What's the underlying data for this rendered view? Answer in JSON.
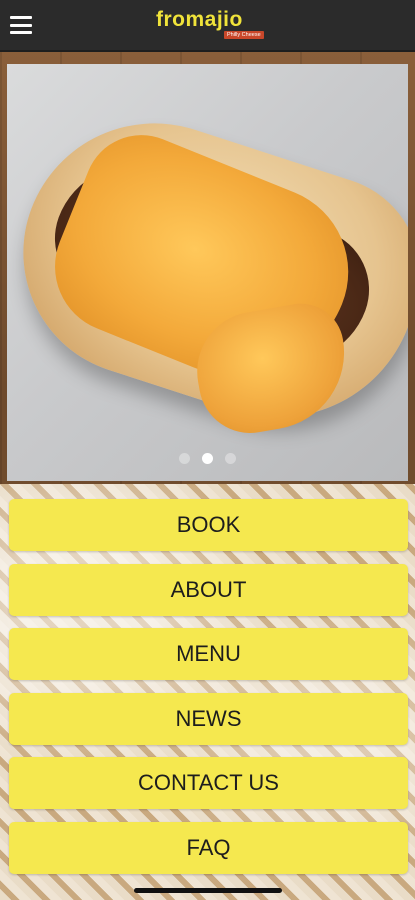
{
  "header": {
    "logo_text": "fromajio",
    "logo_tagline": "Philly Cheese",
    "menu_icon": "hamburger-menu-icon"
  },
  "hero": {
    "image_alt": "Philly cheesesteak sandwich",
    "slides": 3,
    "active_slide": 2
  },
  "nav": {
    "buttons": [
      "BOOK",
      "ABOUT",
      "MENU",
      "NEWS",
      "CONTACT US",
      "FAQ"
    ]
  },
  "colors": {
    "header_bg": "#2b2b2b",
    "logo_yellow": "#f0e33a",
    "button_yellow": "#f5e84f",
    "button_text": "#1d1d1d"
  }
}
